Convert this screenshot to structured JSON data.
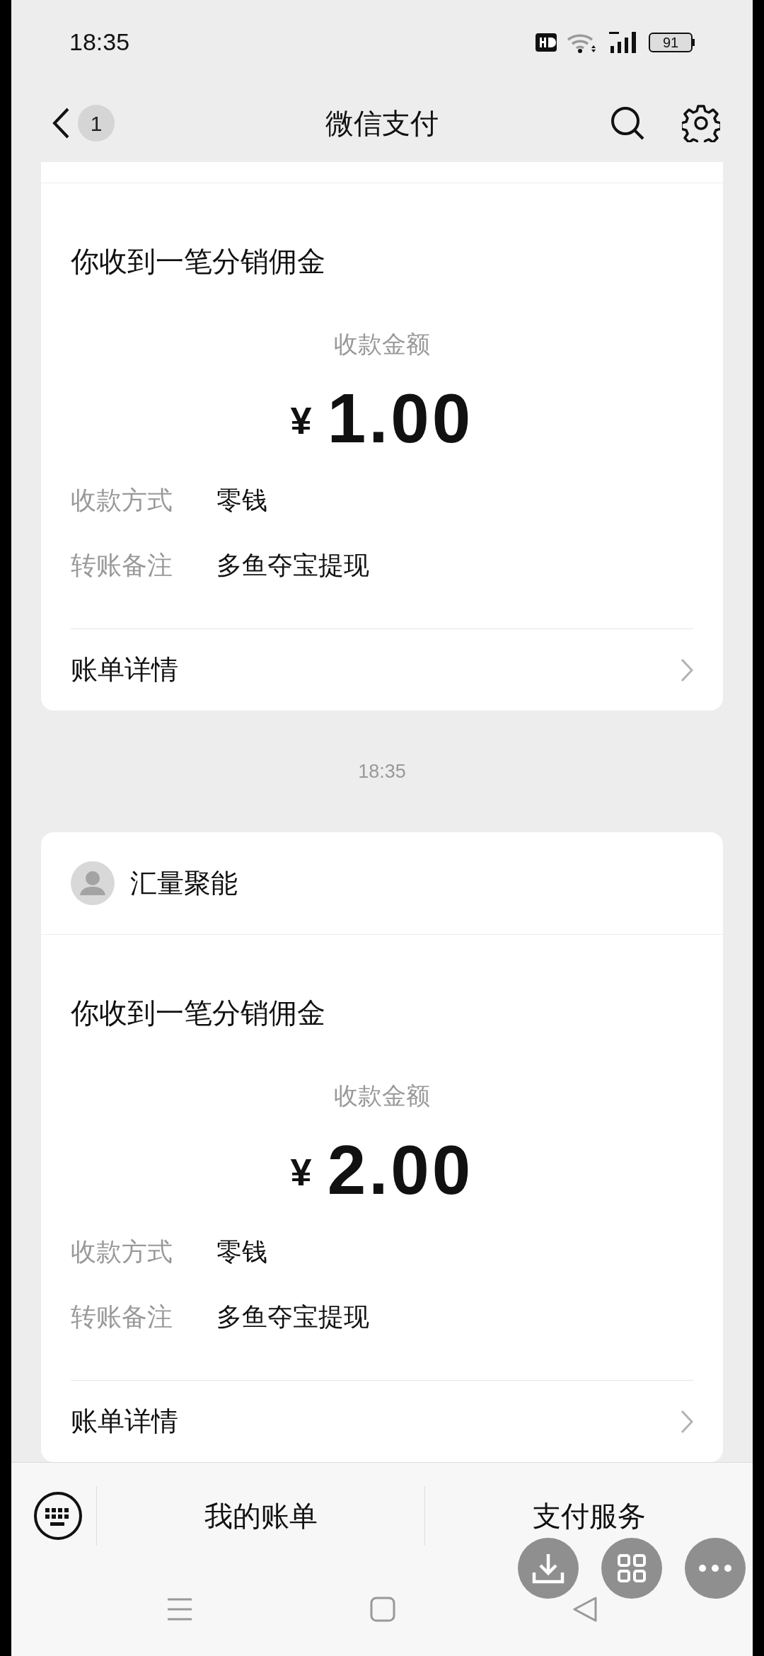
{
  "status_bar": {
    "time": "18:35",
    "battery": "91"
  },
  "nav": {
    "badge": "1",
    "title": "微信支付"
  },
  "messages": [
    {
      "title": "你收到一笔分销佣金",
      "amount_label": "收款金额",
      "currency": "¥",
      "amount": "1.00",
      "fields": [
        {
          "label": "收款方式",
          "value": "零钱"
        },
        {
          "label": "转账备注",
          "value": "多鱼夺宝提现"
        }
      ],
      "detail": "账单详情"
    },
    {
      "time": "18:35",
      "sender": "汇量聚能",
      "title": "你收到一笔分销佣金",
      "amount_label": "收款金额",
      "currency": "¥",
      "amount": "2.00",
      "fields": [
        {
          "label": "收款方式",
          "value": "零钱"
        },
        {
          "label": "转账备注",
          "value": "多鱼夺宝提现"
        }
      ],
      "detail": "账单详情"
    }
  ],
  "bottom_tabs": [
    "我的账单",
    "支付服务"
  ]
}
